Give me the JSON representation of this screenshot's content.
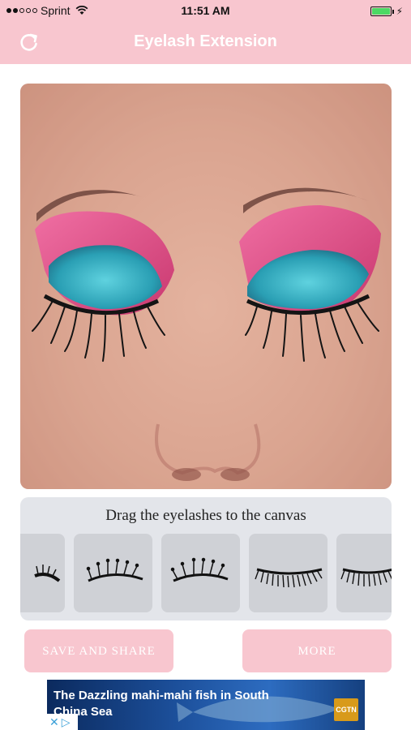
{
  "status_bar": {
    "carrier": "Sprint",
    "time": "11:51 AM",
    "wifi_icon": "wifi-icon",
    "battery_icon": "battery-icon",
    "signal_bars": 2
  },
  "header": {
    "title": "Eyelash Extension",
    "reload_icon": "reload-icon"
  },
  "picker": {
    "title": "Drag the eyelashes to the canvas",
    "styles": [
      "lash-style-1",
      "lash-style-2",
      "lash-style-3",
      "lash-style-4",
      "lash-style-5"
    ]
  },
  "actions": {
    "save_label": "SAVE AND SHARE",
    "more_label": "MORE"
  },
  "ad": {
    "text": "The Dazzling mahi-mahi fish in South China Sea",
    "badge": "CGTN",
    "adchoices_icon": "adchoices-icon"
  },
  "colors": {
    "header_bg": "#f8c6cf",
    "button_bg": "#f8c6cf",
    "picker_bg": "#e3e5ea",
    "tile_bg": "#cfd1d6"
  }
}
